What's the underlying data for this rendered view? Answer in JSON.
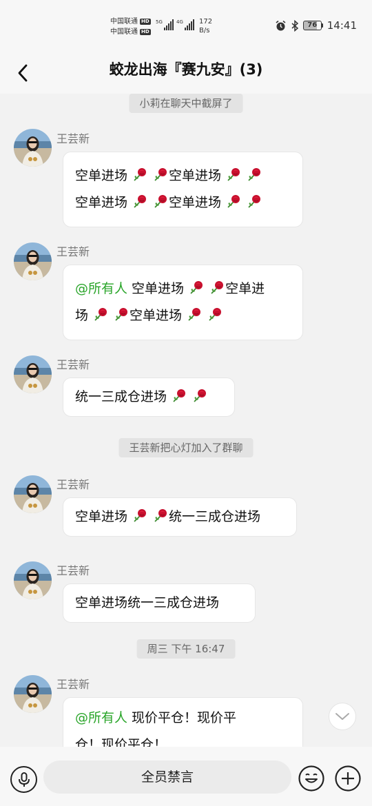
{
  "status_bar": {
    "carrier_1": "中国联通",
    "carrier_2": "中国联通",
    "hd_badge": "HD",
    "signal_1_label": "5G",
    "signal_2_label": "4G",
    "net_speed_value": "172",
    "net_speed_unit": "B/s",
    "battery_level": "76",
    "time": "14:41"
  },
  "nav": {
    "title": "蛟龙出海『赛九安』(3)"
  },
  "messages": {
    "notice_1": "小莉在聊天中截屏了",
    "msg_1": {
      "sender": "王芸新",
      "line_1": "空单进场",
      "line_1b": "空单进场",
      "line_2": "空单进场",
      "line_2b": "空单进场"
    },
    "msg_2": {
      "sender": "王芸新",
      "mention": "@所有人",
      "line_1": " 空单进场",
      "line_1b": "空单进",
      "line_2a": "场",
      "line_2b": "空单进场"
    },
    "msg_3": {
      "sender": "王芸新",
      "text": "统一三成仓进场"
    },
    "notice_2": "王芸新把心灯加入了群聊",
    "msg_4": {
      "sender": "王芸新",
      "text_a": "空单进场",
      "text_b": "统一三成仓进场"
    },
    "msg_5": {
      "sender": "王芸新",
      "text": "空单进场统一三成仓进场"
    },
    "timestamp": "周三 下午 16:47",
    "msg_6": {
      "sender": "王芸新",
      "mention": "@所有人",
      "line_1": " 现价平仓！现价平",
      "line_2": "仓！现价平仓！"
    }
  },
  "input_bar": {
    "mute_label": "全员禁言"
  },
  "colors": {
    "mention": "#2aa52a",
    "background": "#f2f2f2",
    "bubble": "#ffffff"
  }
}
